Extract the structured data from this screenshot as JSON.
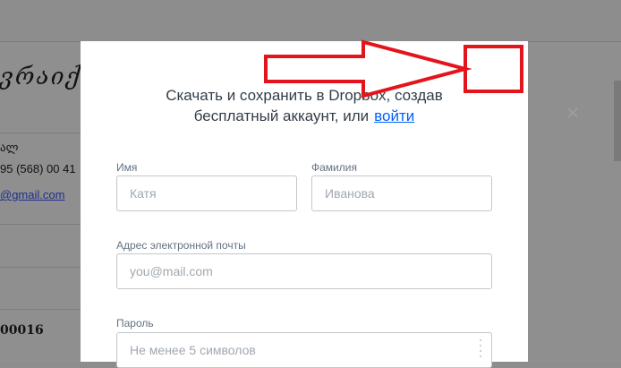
{
  "background": {
    "heading": "ვრაიქ",
    "lines": [
      "ალ",
      "95 (568) 00 41",
      "@gmail.com",
      "00016"
    ]
  },
  "modal": {
    "title_line1": "Скачать и сохранить в Dropbox, создав",
    "title_line2": "бесплатный аккаунт, или",
    "login_link": "войти",
    "close_symbol": "×",
    "first_name": {
      "label": "Имя",
      "placeholder": "Катя"
    },
    "last_name": {
      "label": "Фамилия",
      "placeholder": "Иванова"
    },
    "email": {
      "label": "Адрес электронной почты",
      "placeholder": "you@mail.com"
    },
    "password": {
      "label": "Пароль",
      "placeholder": "Не менее 5 символов"
    }
  },
  "colors": {
    "overlay": "#8d8d8d",
    "annotation_red": "#e3141b",
    "link": "#0061fe"
  }
}
